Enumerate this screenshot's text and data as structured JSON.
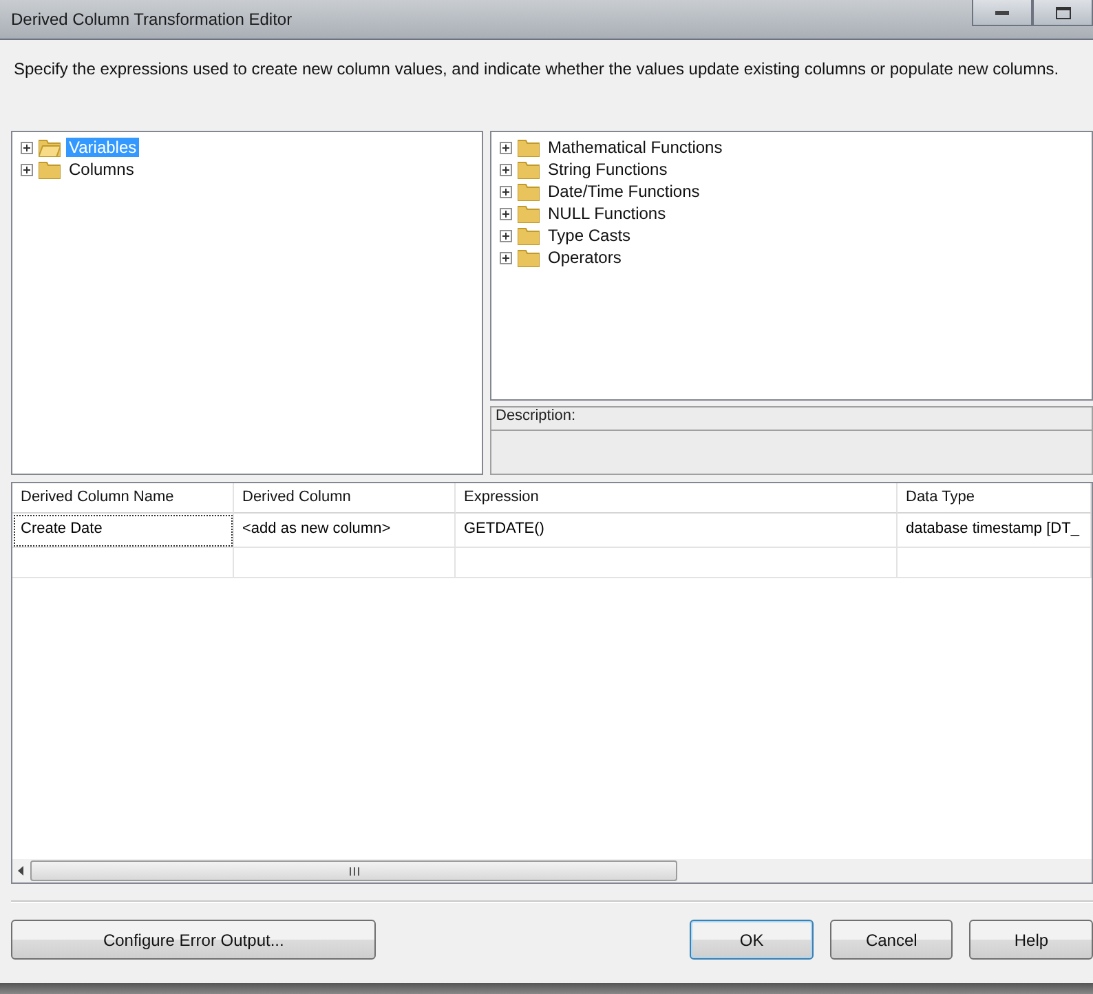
{
  "window": {
    "title": "Derived Column Transformation Editor"
  },
  "instructions": "Specify the expressions used to create new column values, and indicate whether the values update existing columns or populate new columns.",
  "input_tree": [
    {
      "label": "Variables",
      "selected": true,
      "expanded": false
    },
    {
      "label": "Columns",
      "selected": false,
      "expanded": false
    }
  ],
  "function_tree": [
    {
      "label": "Mathematical Functions",
      "selected": false,
      "expanded": false
    },
    {
      "label": "String Functions",
      "selected": false,
      "expanded": false
    },
    {
      "label": "Date/Time Functions",
      "selected": false,
      "expanded": false
    },
    {
      "label": "NULL Functions",
      "selected": false,
      "expanded": false
    },
    {
      "label": "Type Casts",
      "selected": false,
      "expanded": false
    },
    {
      "label": "Operators",
      "selected": false,
      "expanded": false
    }
  ],
  "description": {
    "label": "Description:"
  },
  "grid": {
    "columns": [
      "Derived Column Name",
      "Derived Column",
      "Expression",
      "Data Type"
    ],
    "rows": [
      {
        "cells": [
          "Create Date",
          "<add as new column>",
          "GETDATE()",
          "database timestamp [DT_"
        ],
        "focused": true
      }
    ]
  },
  "buttons": [
    {
      "label": "Configure Error Output...",
      "kind": "side",
      "default": false
    },
    {
      "label": "OK",
      "kind": "main",
      "default": true
    },
    {
      "label": "Cancel",
      "kind": "main",
      "default": false
    },
    {
      "label": "Help",
      "kind": "main",
      "default": false
    }
  ]
}
